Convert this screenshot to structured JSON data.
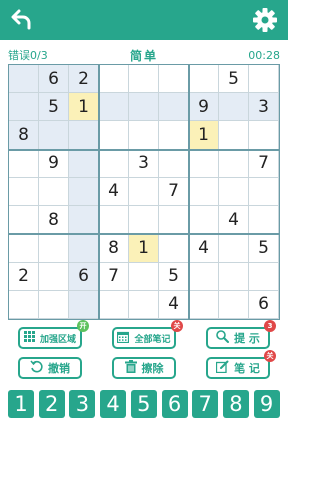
{
  "header": {
    "back_icon": "back-arrow-icon",
    "settings_icon": "gear-icon"
  },
  "status": {
    "mistakes": "错误0/3",
    "difficulty": "简单",
    "timer": "00:28"
  },
  "board": {
    "grid": [
      [
        "",
        "6",
        "2",
        "",
        "",
        "",
        "",
        "5",
        ""
      ],
      [
        "",
        "5",
        "1",
        "",
        "",
        "",
        "9",
        "",
        "3"
      ],
      [
        "8",
        "",
        "",
        "",
        "",
        "",
        "1",
        "",
        ""
      ],
      [
        "",
        "9",
        "",
        "",
        "3",
        "",
        "",
        "",
        "7"
      ],
      [
        "",
        "",
        "",
        "4",
        "",
        "7",
        "",
        "",
        ""
      ],
      [
        "",
        "8",
        "",
        "",
        "",
        "",
        "",
        "4",
        ""
      ],
      [
        "",
        "",
        "",
        "8",
        "1",
        "",
        "4",
        "",
        "5"
      ],
      [
        "2",
        "",
        "6",
        "7",
        "",
        "5",
        "",
        "",
        ""
      ],
      [
        "",
        "",
        "",
        "",
        "",
        "4",
        "",
        "",
        "6"
      ]
    ],
    "selected_value": "1",
    "highlight_color": "#e4ecf5",
    "selected_color": "#fbf1b8"
  },
  "tools": {
    "enhance_area": {
      "label": "加强区域",
      "badge": "开"
    },
    "all_notes": {
      "label": "全部笔记",
      "badge": "关"
    },
    "hint": {
      "label": "提 示",
      "badge": "3"
    },
    "undo": {
      "label": "撤销"
    },
    "erase": {
      "label": "擦除"
    },
    "notes": {
      "label": "笔 记",
      "badge": "关"
    }
  },
  "numpad": [
    "1",
    "2",
    "3",
    "4",
    "5",
    "6",
    "7",
    "8",
    "9"
  ],
  "colors": {
    "accent": "#27a68c",
    "badge_green": "#5ec25e",
    "badge_red": "#e04848"
  }
}
